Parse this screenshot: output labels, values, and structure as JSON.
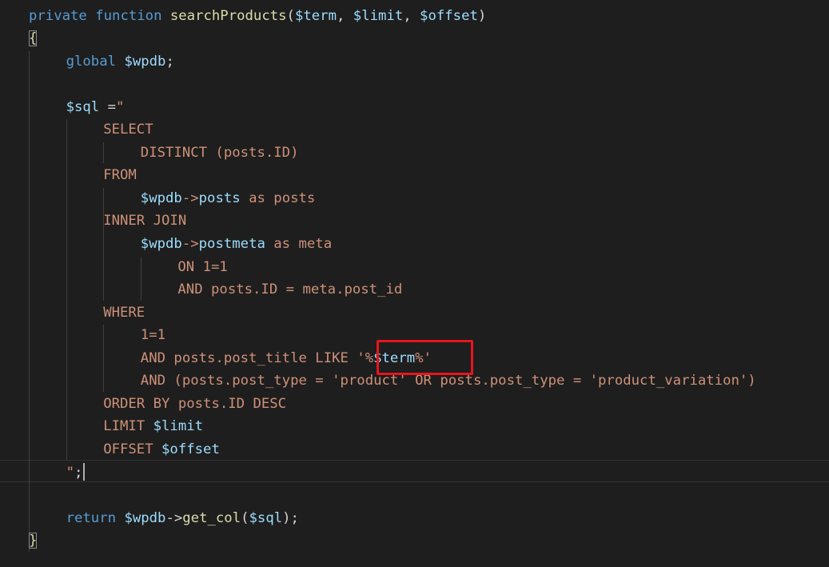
{
  "editor": {
    "language": "php",
    "highlight_color": "#e8141d",
    "lines": [
      {
        "indent": 0,
        "tokens": [
          {
            "t": "private ",
            "c": "keyword"
          },
          {
            "t": "function ",
            "c": "keyword"
          },
          {
            "t": "searchProducts",
            "c": "func"
          },
          {
            "t": "(",
            "c": "punct"
          },
          {
            "t": "$term",
            "c": "var"
          },
          {
            "t": ", ",
            "c": "punct"
          },
          {
            "t": "$limit",
            "c": "var"
          },
          {
            "t": ", ",
            "c": "punct"
          },
          {
            "t": "$offset",
            "c": "var"
          },
          {
            "t": ")",
            "c": "punct"
          }
        ]
      },
      {
        "indent": 0,
        "tokens": [
          {
            "t": "{",
            "c": "brace",
            "match": true
          }
        ]
      },
      {
        "indent": 1,
        "tokens": [
          {
            "t": "global ",
            "c": "keyword"
          },
          {
            "t": "$wpdb",
            "c": "var"
          },
          {
            "t": ";",
            "c": "punct"
          }
        ]
      },
      {
        "indent": 0,
        "tokens": []
      },
      {
        "indent": 1,
        "tokens": [
          {
            "t": "$sql",
            "c": "var"
          },
          {
            "t": " =",
            "c": "punct"
          },
          {
            "t": "\"",
            "c": "string"
          }
        ]
      },
      {
        "indent": 2,
        "tokens": [
          {
            "t": "SELECT",
            "c": "string"
          }
        ]
      },
      {
        "indent": 3,
        "tokens": [
          {
            "t": "DISTINCT (posts.ID)",
            "c": "string"
          }
        ]
      },
      {
        "indent": 2,
        "tokens": [
          {
            "t": "FROM",
            "c": "string"
          }
        ]
      },
      {
        "indent": 3,
        "tokens": [
          {
            "t": "$wpdb",
            "c": "var"
          },
          {
            "t": "->",
            "c": "string"
          },
          {
            "t": "posts",
            "c": "var"
          },
          {
            "t": " as posts",
            "c": "string"
          }
        ]
      },
      {
        "indent": 2,
        "tokens": [
          {
            "t": "INNER JOIN",
            "c": "string"
          }
        ]
      },
      {
        "indent": 3,
        "tokens": [
          {
            "t": "$wpdb",
            "c": "var"
          },
          {
            "t": "->",
            "c": "string"
          },
          {
            "t": "postmeta",
            "c": "var"
          },
          {
            "t": " as meta",
            "c": "string"
          }
        ]
      },
      {
        "indent": 4,
        "tokens": [
          {
            "t": "ON 1=1",
            "c": "string"
          }
        ]
      },
      {
        "indent": 4,
        "tokens": [
          {
            "t": "AND posts.ID = meta.post_id",
            "c": "string"
          }
        ]
      },
      {
        "indent": 2,
        "tokens": [
          {
            "t": "WHERE",
            "c": "string"
          }
        ]
      },
      {
        "indent": 3,
        "tokens": [
          {
            "t": "1=1",
            "c": "string"
          }
        ]
      },
      {
        "indent": 3,
        "tokens": [
          {
            "t": "AND posts.post_title LIKE '%",
            "c": "string"
          },
          {
            "t": "$term",
            "c": "var"
          },
          {
            "t": "%'",
            "c": "string"
          }
        ]
      },
      {
        "indent": 3,
        "tokens": [
          {
            "t": "AND (posts.post_type = 'product' OR posts.post_type = 'product_variation')",
            "c": "string"
          }
        ]
      },
      {
        "indent": 2,
        "tokens": [
          {
            "t": "ORDER BY posts.ID DESC",
            "c": "string"
          }
        ]
      },
      {
        "indent": 2,
        "tokens": [
          {
            "t": "LIMIT ",
            "c": "string"
          },
          {
            "t": "$limit",
            "c": "var"
          }
        ]
      },
      {
        "indent": 2,
        "tokens": [
          {
            "t": "OFFSET ",
            "c": "string"
          },
          {
            "t": "$offset",
            "c": "var"
          }
        ]
      },
      {
        "indent": 1,
        "tokens": [
          {
            "t": "\"",
            "c": "string"
          },
          {
            "t": ";",
            "c": "punct"
          }
        ]
      },
      {
        "indent": 0,
        "tokens": []
      },
      {
        "indent": 1,
        "tokens": [
          {
            "t": "return ",
            "c": "keyword"
          },
          {
            "t": "$wpdb",
            "c": "var"
          },
          {
            "t": "->",
            "c": "punct"
          },
          {
            "t": "get_col",
            "c": "func"
          },
          {
            "t": "(",
            "c": "punct"
          },
          {
            "t": "$sql",
            "c": "var"
          },
          {
            "t": ");",
            "c": "punct"
          }
        ]
      },
      {
        "indent": 0,
        "tokens": [
          {
            "t": "}",
            "c": "brace",
            "match": true
          }
        ]
      }
    ]
  }
}
